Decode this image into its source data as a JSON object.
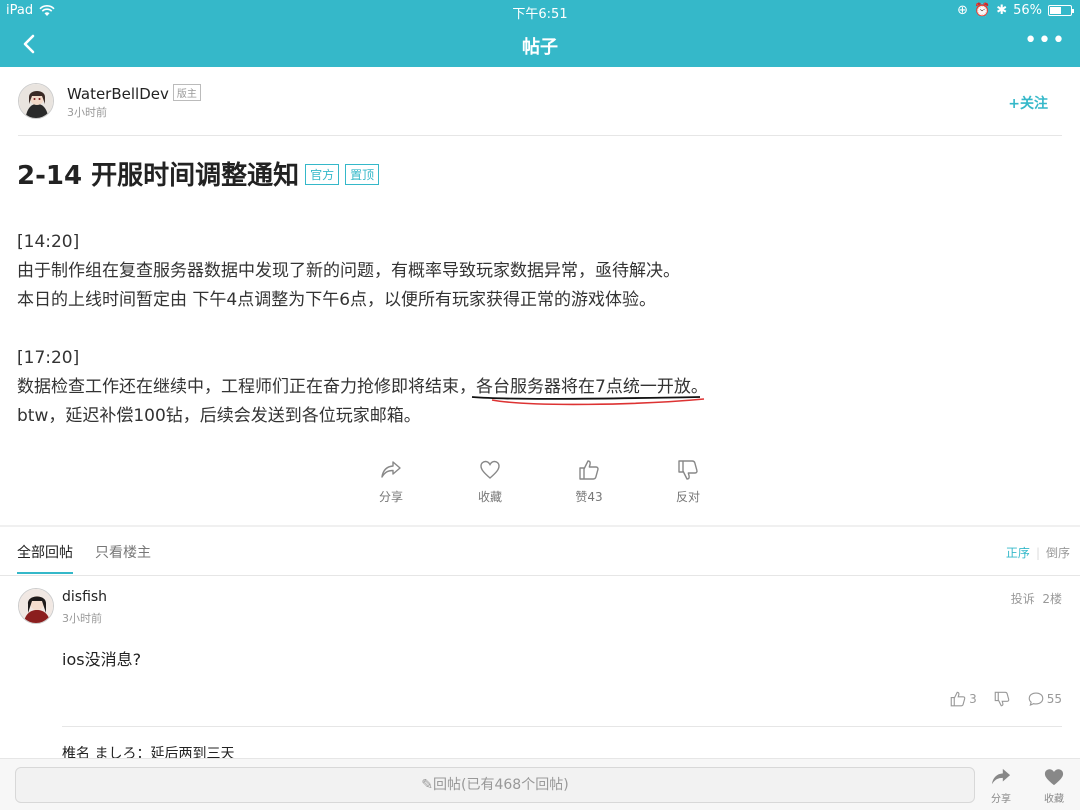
{
  "status_bar": {
    "device": "iPad",
    "time": "下午6:51",
    "battery": "56%",
    "battery_level": 0.56
  },
  "nav": {
    "title": "帖子"
  },
  "post": {
    "author": "WaterBellDev",
    "author_badge": "版主",
    "time": "3小时前",
    "follow": "+关注",
    "title": "2-14 开服时间调整通知",
    "tags": [
      "官方",
      "置顶"
    ],
    "lines": {
      "l1": "[14:20]",
      "l2": "由于制作组在复查服务器数据中发现了新的问题，有概率导致玩家数据异常，亟待解决。",
      "l3": "本日的上线时间暂定由 下午4点调整为下午6点，以便所有玩家获得正常的游戏体验。",
      "l4": "[17:20]",
      "l5a": "数据检查工作还在继续中，工程师们正在奋力抢修即将结束，",
      "l5b": "各台服务器将在7点统一开放",
      "l5c": "。",
      "l6": "btw，延迟补偿100钻，后续会发送到各位玩家邮箱。"
    },
    "actions": {
      "share": "分享",
      "favorite": "收藏",
      "like": "赞43",
      "dislike": "反对"
    }
  },
  "tabs": {
    "all": "全部回帖",
    "owner_only": "只看楼主",
    "order_asc": "正序",
    "order_desc": "倒序"
  },
  "reply": {
    "author": "disfish",
    "time": "3小时前",
    "report": "投诉",
    "floor": "2楼",
    "content": "ios没消息?",
    "likes": "3",
    "comments": "55",
    "sub_reply": "椎名 ましろ：延后两到三天"
  },
  "bottom_bar": {
    "reply_placeholder": "✎回帖(已有468个回帖)",
    "share": "分享",
    "favorite": "收藏"
  }
}
